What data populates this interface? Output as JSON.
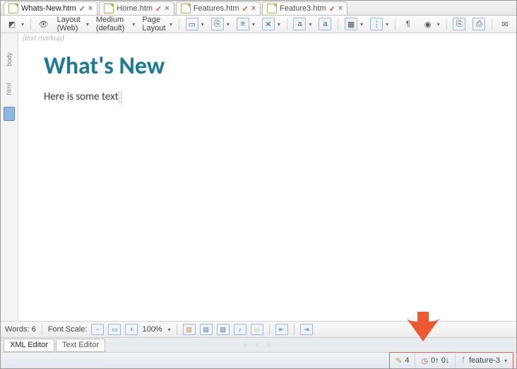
{
  "tabs": [
    {
      "label": "Whats-New.htm",
      "modified": true
    },
    {
      "label": "Home.htm",
      "modified": true
    },
    {
      "label": "Features.htm",
      "modified": true
    },
    {
      "label": "Feature3.htm",
      "modified": true
    }
  ],
  "toolbar": {
    "layout": "Layout (Web)",
    "medium": "Medium (default)",
    "pageLayout": "Page Layout"
  },
  "gutter": {
    "body": "body",
    "html": "html"
  },
  "content": {
    "markupLabel": "(text markup)",
    "heading": "What's New",
    "body": "Here is some text"
  },
  "bottom": {
    "words": "Words: 6",
    "fontScaleLabel": "Font Scale:",
    "zoom": "100%"
  },
  "editorTabs": [
    "XML Editor",
    "Text Editor"
  ],
  "status": {
    "changes": "4",
    "sync": "0↑ 0↓",
    "branch": "feature-3"
  }
}
